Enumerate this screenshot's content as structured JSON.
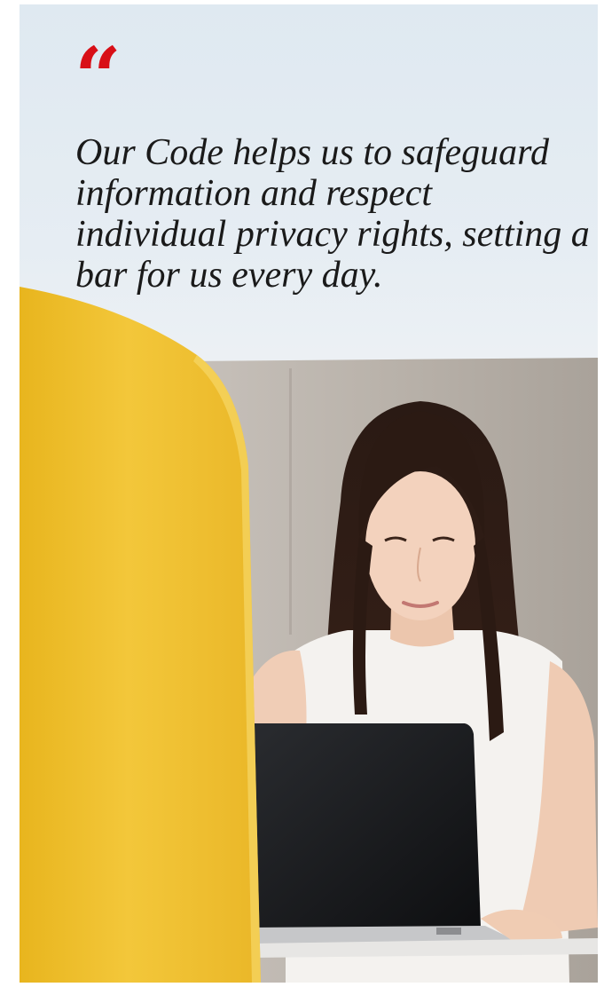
{
  "quote": {
    "mark": "“",
    "text": "Our Code helps us to safeguard information and respect individual privacy rights, setting a bar for us every day."
  },
  "photo": {
    "subject": "woman-using-laptop-icon"
  },
  "colors": {
    "accent": "#d80f17",
    "quote_text": "#1a1a1a",
    "sky": "#e2ebf2",
    "booth_wall": "#b9b2aa",
    "yellow_panel": "#f0c02c"
  }
}
